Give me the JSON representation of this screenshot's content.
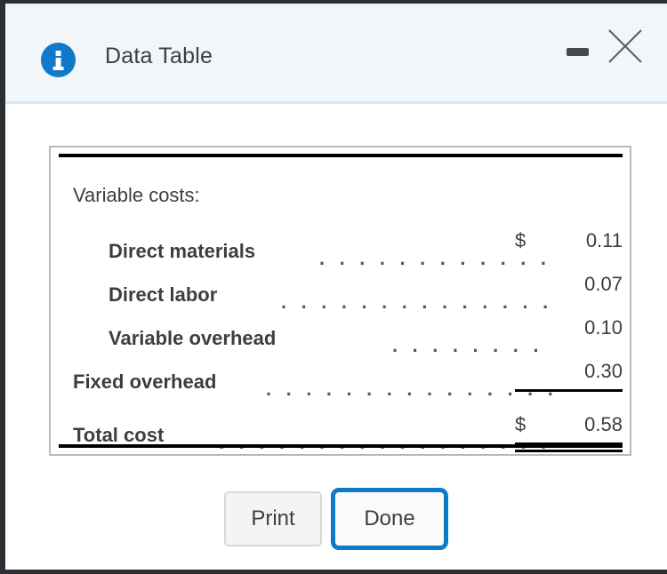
{
  "window": {
    "title": "Data Table",
    "icon": "info-icon",
    "icon_color": "#1278c8",
    "titlebar_bg": "#f1f6fa",
    "divider_color": "#d6e8f7",
    "minimize_label": "minimize-icon",
    "close_label": "close-icon"
  },
  "table": {
    "header_label": "Variable costs:",
    "rows": [
      {
        "label": "Variable costs:",
        "indent": false,
        "bold": false,
        "leader": false,
        "symbol": "",
        "value": "",
        "rule": "none"
      },
      {
        "label": "Direct materials",
        "indent": true,
        "bold": true,
        "leader": true,
        "symbol": "$",
        "value": "0.11",
        "rule": "none"
      },
      {
        "label": "Direct labor",
        "indent": true,
        "bold": true,
        "leader": true,
        "symbol": "",
        "value": "0.07",
        "rule": "none"
      },
      {
        "label": "Variable overhead",
        "indent": true,
        "bold": true,
        "leader": true,
        "symbol": "",
        "value": "0.10",
        "rule": "none"
      },
      {
        "label": "Fixed overhead",
        "indent": false,
        "bold": true,
        "leader": true,
        "symbol": "",
        "value": "0.30",
        "rule": "single"
      },
      {
        "label": "Total cost",
        "indent": false,
        "bold": true,
        "leader": true,
        "symbol": "$",
        "value": "0.58",
        "rule": "double"
      }
    ],
    "leader_dots": ". . . . . . . . . . . . . . . . . . . . . . . . . . . ."
  },
  "buttons": {
    "print_label": "Print",
    "done_label": "Done",
    "focus_color": "#0d7bc8"
  }
}
